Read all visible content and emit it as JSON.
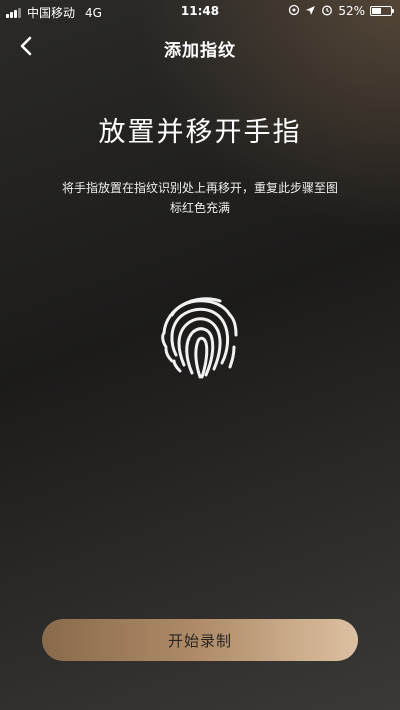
{
  "status_bar": {
    "carrier": "中国移动",
    "network": "4G",
    "time": "11:48",
    "battery_percent": "52%",
    "battery_level": 0.52
  },
  "nav": {
    "title": "添加指纹"
  },
  "main": {
    "headline": "放置并移开手指",
    "instruction": "将手指放置在指纹识别处上再移开，重复此步骤至图标红色充满"
  },
  "actions": {
    "start_label": "开始录制"
  },
  "icons": {
    "back": "chevron-left-icon",
    "fingerprint": "fingerprint-icon"
  },
  "colors": {
    "button_start": "#8a6a4c",
    "button_end": "#dcc0a2"
  }
}
